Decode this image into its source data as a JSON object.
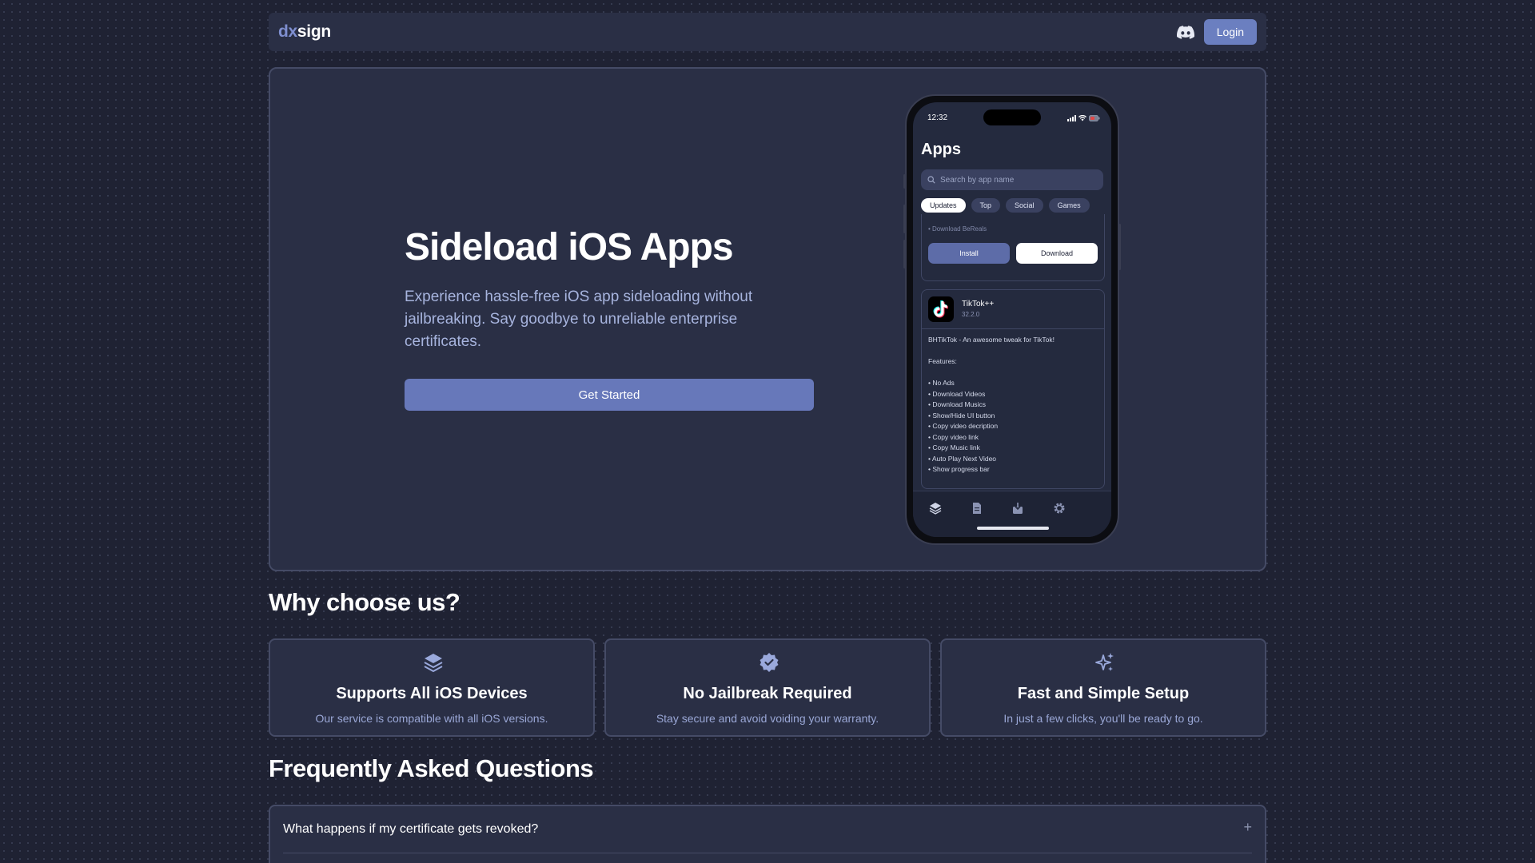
{
  "nav": {
    "logo_prefix": "dx",
    "logo_suffix": "sign",
    "login_label": "Login",
    "icons": [
      "discord-icon"
    ]
  },
  "hero": {
    "title": "Sideload iOS Apps",
    "description": "Experience hassle-free iOS app sideloading without jailbreaking. Say goodbye to unreliable enterprise certificates.",
    "cta_label": "Get Started"
  },
  "phone": {
    "time": "12:32",
    "apps_title": "Apps",
    "search_placeholder": "Search by app name",
    "chips": [
      "Updates",
      "Top",
      "Social",
      "Games"
    ],
    "active_chip": "Updates",
    "card1_faded_line": "• Download BeReals",
    "install_label": "Install",
    "download_label": "Download",
    "app": {
      "name": "TikTok++",
      "version": "32.2.0",
      "description": "BHTikTok - An awesome tweak for TikTok!\n\nFeatures:\n\n• No Ads\n• Download Videos\n• Download Musics\n• Show/Hide UI button\n• Copy video decription\n• Copy video link\n• Copy Music link\n• Auto Play Next Video\n• Show progress bar"
    },
    "tab_icons": [
      "layers-icon",
      "file-icon",
      "download-icon",
      "gear-icon"
    ]
  },
  "why": {
    "title": "Why choose us?",
    "features": [
      {
        "icon": "layers-icon",
        "title": "Supports All iOS Devices",
        "desc": "Our service is compatible with all iOS versions."
      },
      {
        "icon": "verified-badge-icon",
        "title": "No Jailbreak Required",
        "desc": "Stay secure and avoid voiding your warranty."
      },
      {
        "icon": "sparkles-icon",
        "title": "Fast and Simple Setup",
        "desc": "In just a few clicks, you'll be ready to go."
      }
    ]
  },
  "faq": {
    "title": "Frequently Asked Questions",
    "items": [
      {
        "question": "What happens if my certificate gets revoked?"
      }
    ]
  },
  "colors": {
    "background": "#1f2233",
    "panel": "#2a2f45",
    "accent": "#6778ba",
    "logo_accent": "#7f8fd0",
    "muted_text": "#a7b4de"
  }
}
